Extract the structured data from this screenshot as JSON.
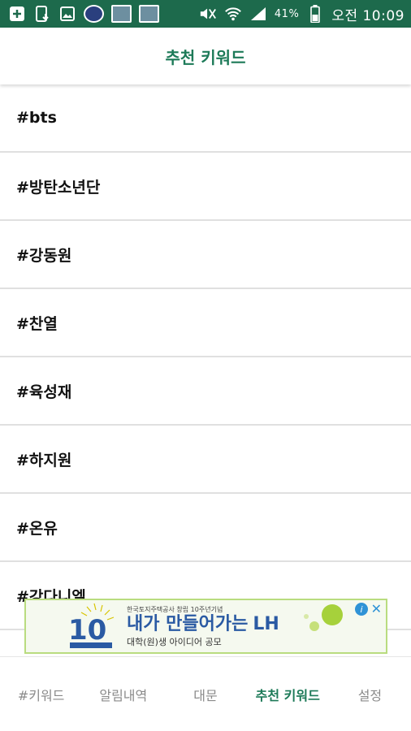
{
  "status_bar": {
    "battery_percent": "41%",
    "time": "오전 10:09",
    "icons": [
      "add-box-icon",
      "phone-download-icon",
      "image-icon",
      "app-thumbnail-icon",
      "app-thumbnail-icon",
      "app-thumbnail-icon",
      "mute-icon",
      "wifi-icon",
      "signal-icon",
      "battery-icon"
    ]
  },
  "header": {
    "title": "추천 키워드"
  },
  "keywords": [
    "#bts",
    "#방탄소년단",
    "#강동원",
    "#찬열",
    "#육성재",
    "#하지원",
    "#온유",
    "#강다니엘"
  ],
  "ad": {
    "small_text": "한국토지주택공사 창립 10주년기념",
    "headline": "내가 만들어가는",
    "brand": "LH",
    "subline": "대학(원)생 아이디어 공모",
    "logo_number": "10",
    "info_icon": "info-icon",
    "close_icon": "close-icon"
  },
  "bottom_nav": {
    "tabs": [
      "#키워드",
      "알림내역",
      "대문",
      "추천 키워드",
      "설정"
    ],
    "active_index": 3
  },
  "colors": {
    "status_bar": "#1d6a4c",
    "accent": "#1d7a58",
    "divider": "#e0e0e0",
    "ad_border": "#b9dc7f",
    "ad_headline": "#2a5aa3"
  }
}
